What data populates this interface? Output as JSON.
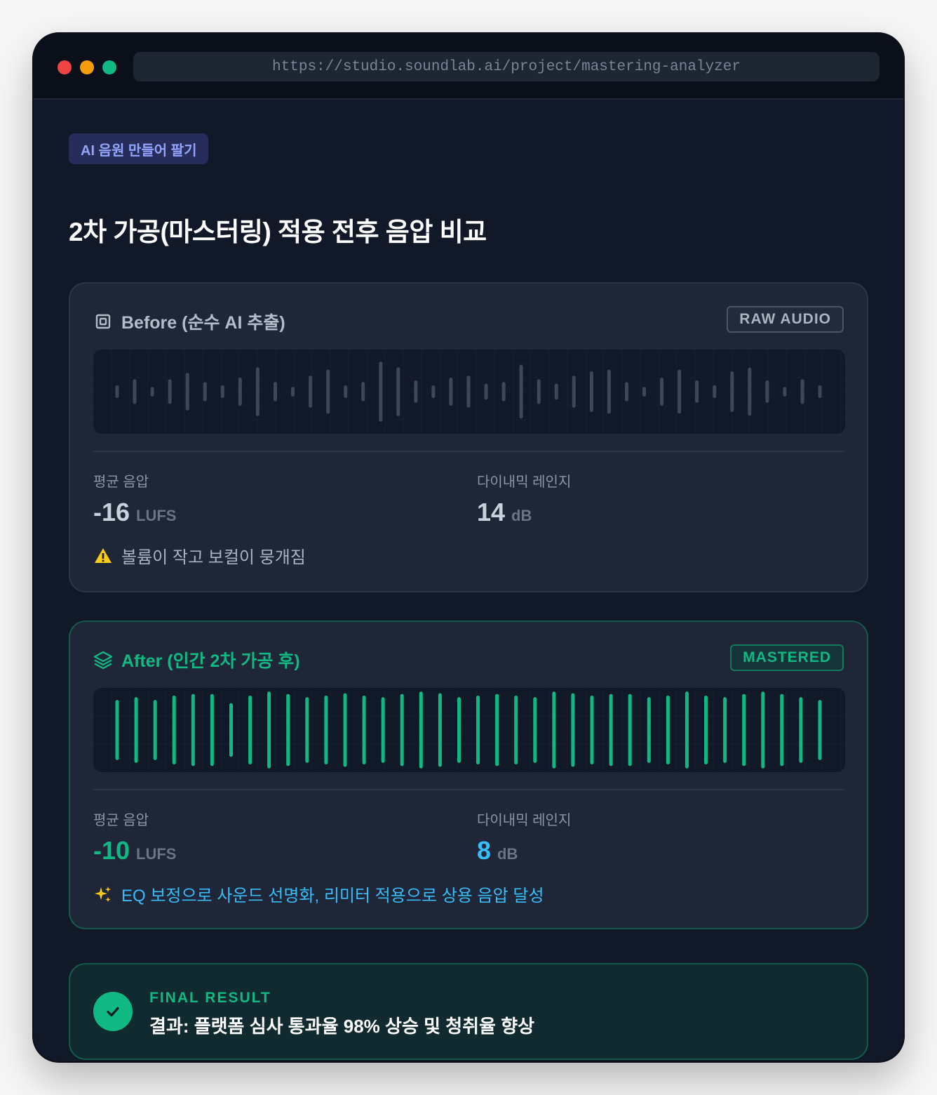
{
  "browser": {
    "url": "https://studio.soundlab.ai/project/mastering-analyzer"
  },
  "tag": "AI 음원 만들어 팔기",
  "title": "2차 가공(마스터링) 적용 전후 음압 비교",
  "before": {
    "heading": "Before (순수 AI 추출)",
    "icon": "cpu-icon",
    "badge": "RAW AUDIO",
    "loudness_label": "평균 음압",
    "loudness_value": "-16",
    "loudness_unit": "LUFS",
    "dynamic_label": "다이내믹 레인지",
    "dynamic_value": "14",
    "dynamic_unit": "dB",
    "note_icon": "warning-icon",
    "note": "볼륨이 작고 보컬이 뭉개짐",
    "bar_color": "#3e4759",
    "bar_levels": [
      0.16,
      0.31,
      0.12,
      0.31,
      0.47,
      0.24,
      0.16,
      0.35,
      0.61,
      0.24,
      0.12,
      0.4,
      0.55,
      0.16,
      0.24,
      0.75,
      0.61,
      0.28,
      0.16,
      0.35,
      0.4,
      0.2,
      0.24,
      0.67,
      0.31,
      0.2,
      0.4,
      0.51,
      0.55,
      0.24,
      0.12,
      0.35,
      0.55,
      0.28,
      0.16,
      0.51,
      0.6,
      0.28,
      0.12,
      0.31,
      0.16
    ]
  },
  "after": {
    "heading": "After (인간 2차 가공 후)",
    "icon": "layers-icon",
    "badge": "MASTERED",
    "loudness_label": "평균 음압",
    "loudness_value": "-10",
    "loudness_unit": "LUFS",
    "dynamic_label": "다이내믹 레인지",
    "dynamic_value": "8",
    "dynamic_unit": "dB",
    "note_icon": "sparkles-icon",
    "note": "EQ 보정으로 사운드 선명화, 리미터 적용으로 상용 음압 달성",
    "bar_color": "#10b981",
    "bar_levels": [
      0.75,
      0.82,
      0.75,
      0.86,
      0.9,
      0.9,
      0.67,
      0.86,
      0.96,
      0.9,
      0.82,
      0.86,
      0.92,
      0.86,
      0.82,
      0.9,
      0.96,
      0.92,
      0.82,
      0.86,
      0.9,
      0.86,
      0.82,
      0.96,
      0.92,
      0.86,
      0.9,
      0.9,
      0.82,
      0.86,
      0.96,
      0.86,
      0.82,
      0.9,
      0.96,
      0.9,
      0.82,
      0.75
    ],
    "bar_count_note": ""
  },
  "final": {
    "label": "FINAL RESULT",
    "text": "결과: 플랫폼 심사 통과율 98% 상승 및 청취율 향상",
    "icon": "check-icon"
  }
}
